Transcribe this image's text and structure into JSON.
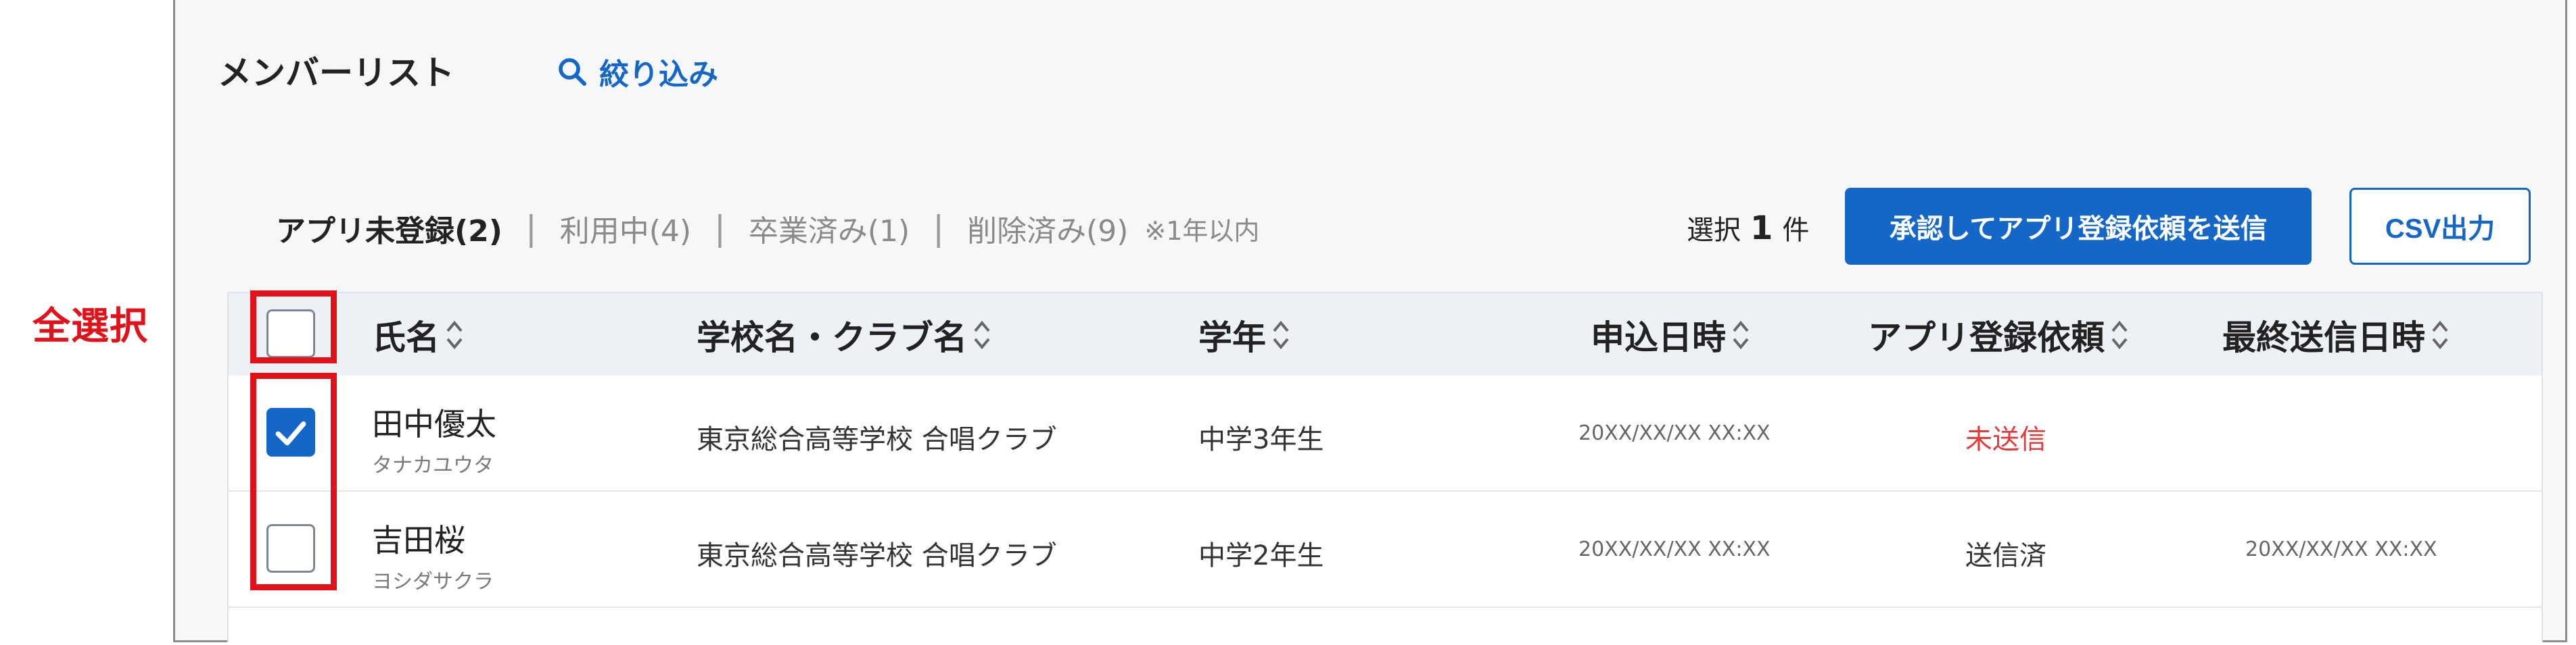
{
  "annotation": {
    "label": "全選択"
  },
  "panel": {
    "title": "メンバーリスト",
    "filter_label": "絞り込み"
  },
  "tabs": [
    {
      "label": "アプリ未登録(2)",
      "active": true
    },
    {
      "label": "利用中(4)",
      "active": false
    },
    {
      "label": "卒業済み(1)",
      "active": false
    },
    {
      "label": "削除済み(9)",
      "active": false
    }
  ],
  "tab_separator": "|",
  "tab_note": "※1年以内",
  "selection": {
    "prefix": "選択",
    "count": "1",
    "suffix": "件"
  },
  "buttons": {
    "send": "承認してアプリ登録依頼を送信",
    "csv": "CSV出力"
  },
  "table": {
    "headers": {
      "name": "氏名",
      "school": "学校名・クラブ名",
      "grade": "学年",
      "applied": "申込日時",
      "request": "アプリ登録依頼",
      "last_sent": "最終送信日時"
    },
    "rows": [
      {
        "checked": true,
        "name": "田中優太",
        "kana": "タナカユウタ",
        "school": "東京総合高等学校 合唱クラブ",
        "grade": "中学3年生",
        "applied": "20XX/XX/XX XX:XX",
        "request": "未送信",
        "last_sent": ""
      },
      {
        "checked": false,
        "name": "吉田桜",
        "kana": "ヨシダサクラ",
        "school": "東京総合高等学校 合唱クラブ",
        "grade": "中学2年生",
        "applied": "20XX/XX/XX XX:XX",
        "request": "送信済",
        "last_sent": "20XX/XX/XX XX:XX"
      }
    ]
  },
  "colors": {
    "primary": "#1467c7",
    "annotation": "#e0131a",
    "unsent": "#e43a3a"
  }
}
